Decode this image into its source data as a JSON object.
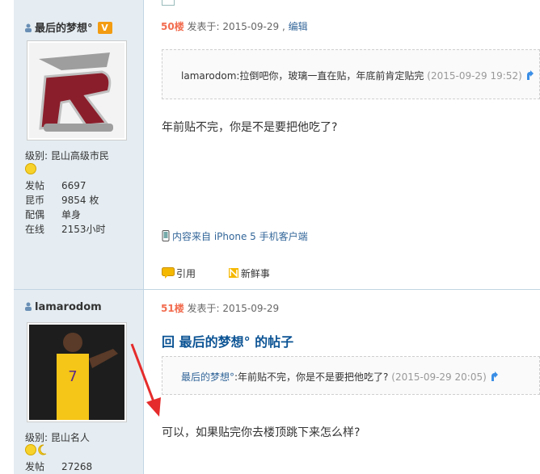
{
  "post1": {
    "username": "最后的梦想°",
    "badge": "V",
    "level_label": "级别:",
    "level_value": "昆山高级市民",
    "stats": [
      {
        "k": "发帖",
        "v": "6697"
      },
      {
        "k": "昆币",
        "v": "9854 枚"
      },
      {
        "k": "配偶",
        "v": "单身"
      },
      {
        "k": "在线",
        "v": "2153小时"
      }
    ],
    "floor": "50楼",
    "posted": "发表于: 2015-09-29 ,",
    "edit": "编辑",
    "quote_text": "lamarodom:拉倒吧你，玻璃一直在贴，年底前肯定贴完",
    "quote_time": "(2015-09-29 19:52)",
    "body": "年前贴不完，你是不是要把他吃了?",
    "mobile": "内容来自 iPhone 5 手机客户端",
    "action_quote": "引用",
    "action_fresh": "新鲜事"
  },
  "post2": {
    "username": "lamarodom",
    "level_label": "级别:",
    "level_value": "昆山名人",
    "stats": [
      {
        "k": "发帖",
        "v": "27268"
      }
    ],
    "floor": "51楼",
    "posted": "发表于: 2015-09-29",
    "reply_title": "回 最后的梦想° 的帖子",
    "quote_user": "最后的梦想°",
    "quote_text": ":年前贴不完，你是不是要把他吃了?",
    "quote_time": "(2015-09-29 20:05)",
    "body": "可以，如果贴完你去楼顶跳下来怎么样?"
  },
  "colors": {
    "sidebar": "#e5edf2",
    "floor": "#f26c4f",
    "link": "#336699"
  }
}
